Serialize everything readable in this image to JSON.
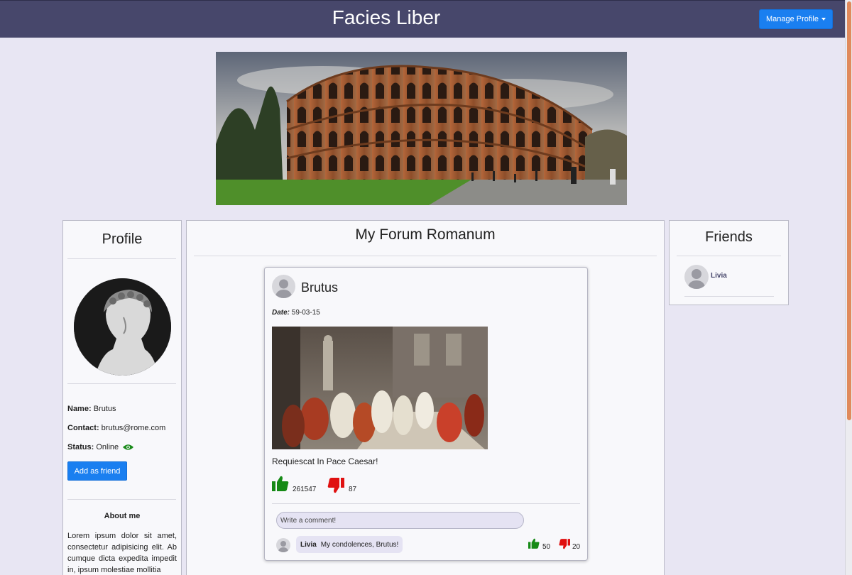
{
  "navbar": {
    "brand": "Facies Liber",
    "manage_label": "Manage Profile"
  },
  "banner": {
    "alt": "Colosseum in Rome"
  },
  "profile": {
    "title": "Profile",
    "name_label": "Name:",
    "name": "Brutus",
    "contact_label": "Contact:",
    "contact": "brutus@rome.com",
    "status_label": "Status:",
    "status": "Online",
    "status_color": "#1a8a1a",
    "add_friend_label": "Add as friend",
    "about_title": "About me",
    "about_text": "Lorem ipsum dolor sit amet, consectetur adipisicing elit. Ab cumque dicta expedita impedit in, ipsum molestiae mollitia"
  },
  "forum": {
    "title": "My Forum Romanum",
    "post": {
      "user": "Brutus",
      "date_label": "Date:",
      "date": "59-03-15",
      "text": "Requiescat In Pace Caesar!",
      "likes": "261547",
      "dislikes": "87",
      "like_color": "#168a16",
      "dislike_color": "#e01010",
      "comment_placeholder": "Write a comment!",
      "comment": {
        "user": "Livia",
        "text": "My condolences, Brutus!",
        "likes": "50",
        "dislikes": "20"
      }
    }
  },
  "friends": {
    "title": "Friends",
    "items": [
      {
        "name": "Livia"
      }
    ]
  },
  "colors": {
    "navbar": "#47476b",
    "accent": "#1a7ff0",
    "background": "#e8e6f3"
  }
}
